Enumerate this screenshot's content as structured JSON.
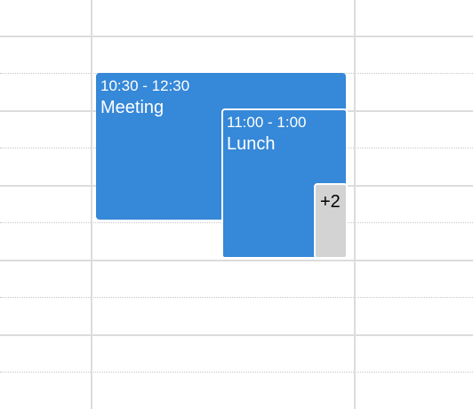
{
  "events": [
    {
      "time": "10:30 - 12:30",
      "title": "Meeting",
      "color": "#3688d8"
    },
    {
      "time": "11:00 - 1:00",
      "title": "Lunch",
      "color": "#3688d8"
    }
  ],
  "more_badge": {
    "label": "+2",
    "color": "#d3d3d3"
  },
  "grid": {
    "line_color": "#dcdcdc"
  }
}
